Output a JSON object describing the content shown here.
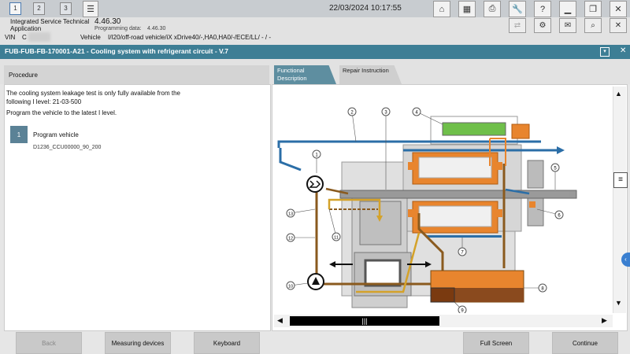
{
  "topbar": {
    "tabs": [
      "1",
      "2",
      "3"
    ],
    "datetime": "22/03/2024 10:17:55"
  },
  "app": {
    "name": "Integrated Service Technical Application",
    "version": "4.46.30",
    "programming_label": "Programming data:",
    "programming_version": "4.46.30"
  },
  "vehicle": {
    "vin_label": "VIN",
    "vin_value": "C",
    "vehicle_label": "Vehicle",
    "vehicle_value": "I/I20/off-road vehicle/iX xDrive40/-,HA0,HA0/-/ECE/LL/ - / -"
  },
  "document": {
    "title": "FUB-FUB-FB-170001-A21 - Cooling system with refrigerant circuit - V.7"
  },
  "left": {
    "tab": "Procedure",
    "text1": "The cooling system leakage test is only fully available from the following I level: 21-03-500",
    "text2": "Program the vehicle to the latest I level.",
    "step_number": "1",
    "step_title": "Program vehicle",
    "step_code": "D1236_CCU00000_90_200"
  },
  "right": {
    "tab_active": "Functional Description",
    "tab_inactive": "Repair Instruction",
    "callouts": [
      "1",
      "2",
      "3",
      "4",
      "5",
      "6",
      "7",
      "8",
      "9",
      "10",
      "11",
      "12",
      "13"
    ]
  },
  "bottom": {
    "back": "Back",
    "measuring": "Measuring devices",
    "keyboard": "Keyboard",
    "fullscreen": "Full Screen",
    "continue": "Continue"
  }
}
